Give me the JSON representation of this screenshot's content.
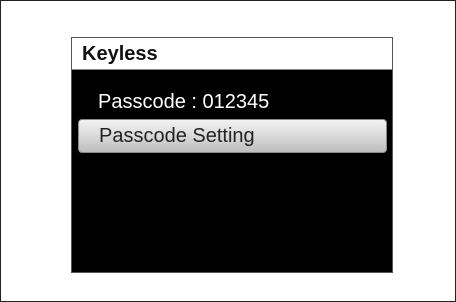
{
  "screen": {
    "title": "Keyless",
    "passcode_line": "Passcode : 012345",
    "menu_items": [
      {
        "label": "Passcode Setting",
        "selected": true
      }
    ]
  }
}
